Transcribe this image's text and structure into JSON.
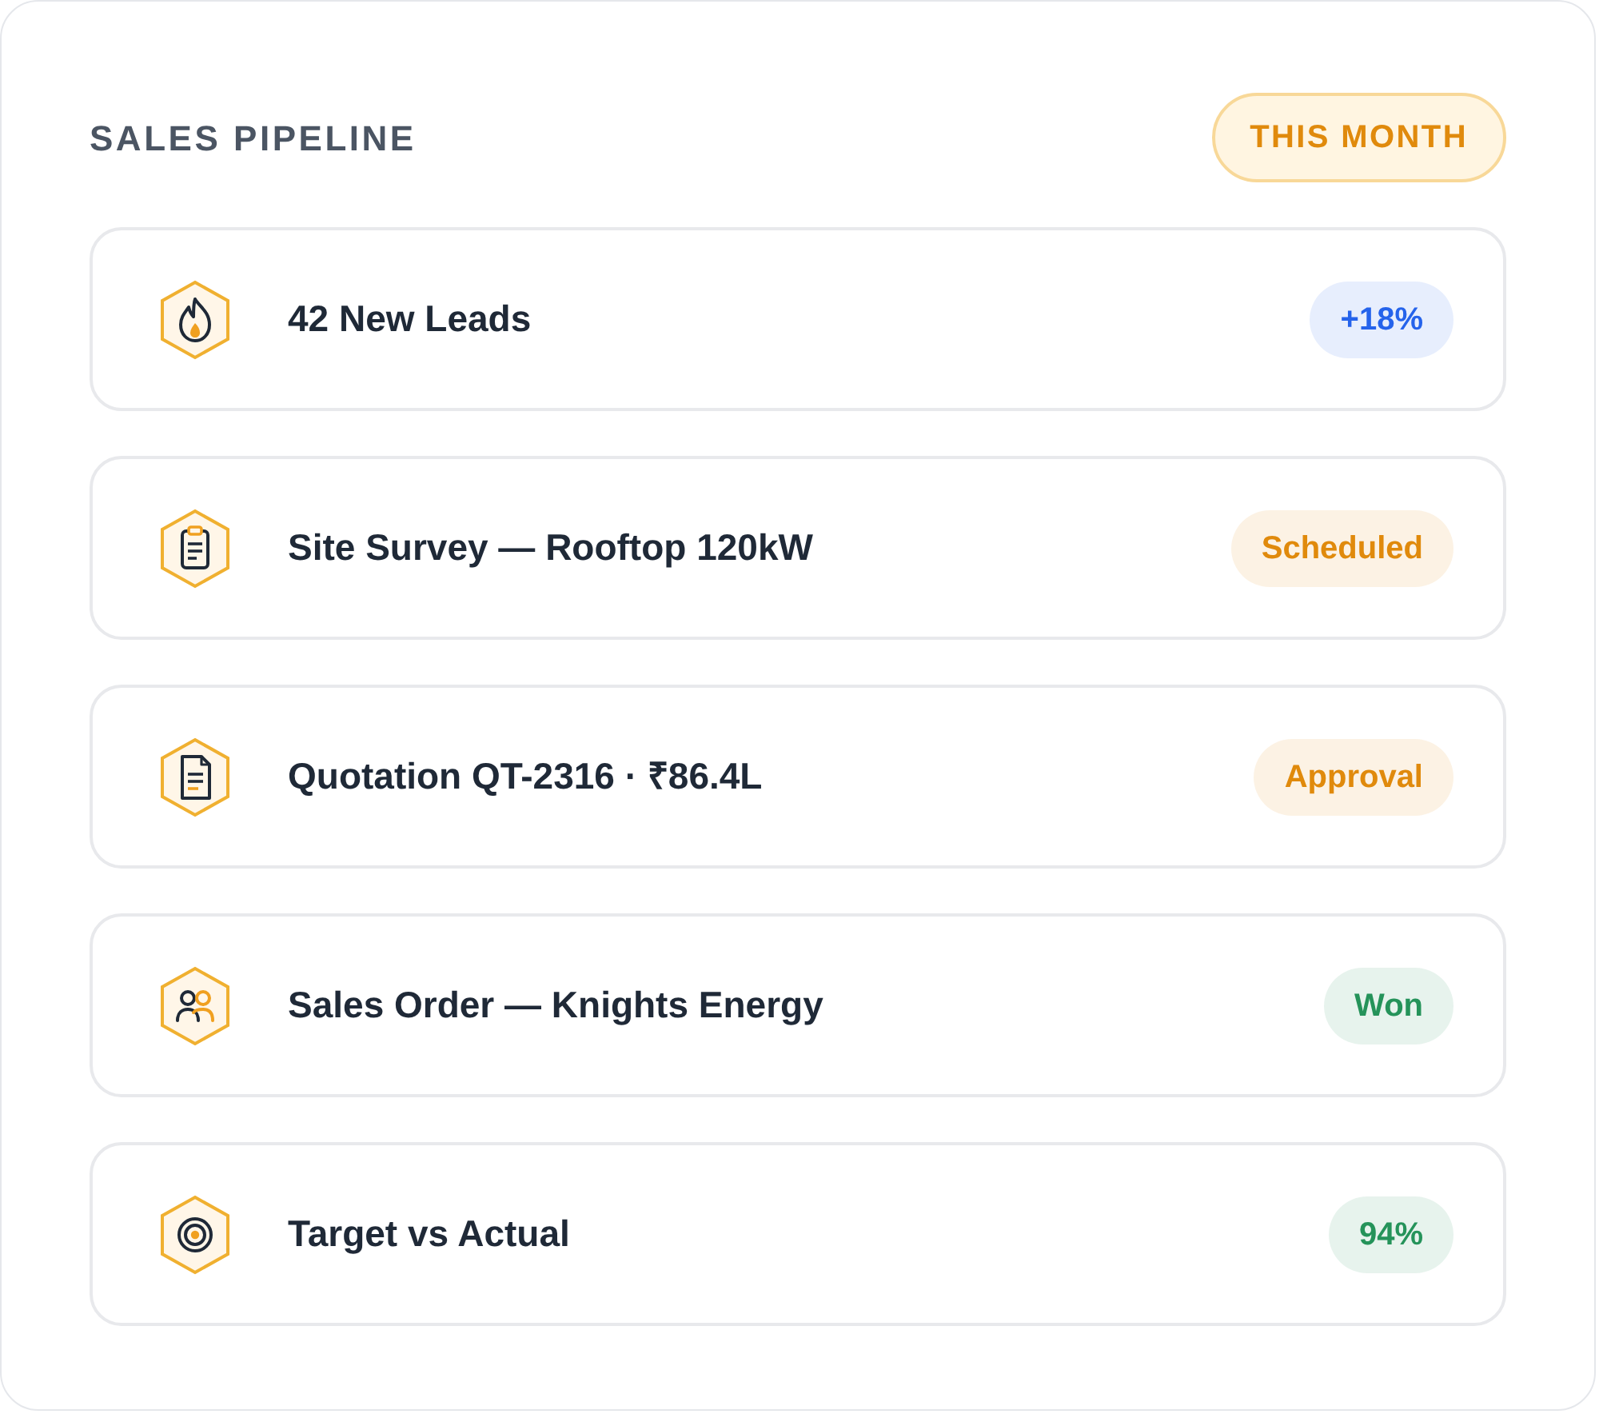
{
  "header": {
    "title": "SALES PIPELINE",
    "period": "THIS MONTH"
  },
  "rows": [
    {
      "kind": "leads",
      "label": "42 New Leads",
      "badge": {
        "text": "+18%",
        "color": "#2563eb"
      }
    },
    {
      "kind": "survey",
      "label": "Site Survey — Rooftop 120kW",
      "badge": {
        "text": "Scheduled",
        "color": "#e08a0c"
      }
    },
    {
      "kind": "quotation",
      "label": "Quotation QT-2316 · ₹86.4L",
      "badge": {
        "text": "Approval",
        "color": "#e08a0c"
      }
    },
    {
      "kind": "order",
      "label": "Sales Order — Knights Energy",
      "badge": {
        "text": "Won",
        "color": "#25935a"
      }
    },
    {
      "kind": "target",
      "label": "Target vs Actual",
      "badge": {
        "text": "94%",
        "color": "#25935a"
      }
    }
  ]
}
